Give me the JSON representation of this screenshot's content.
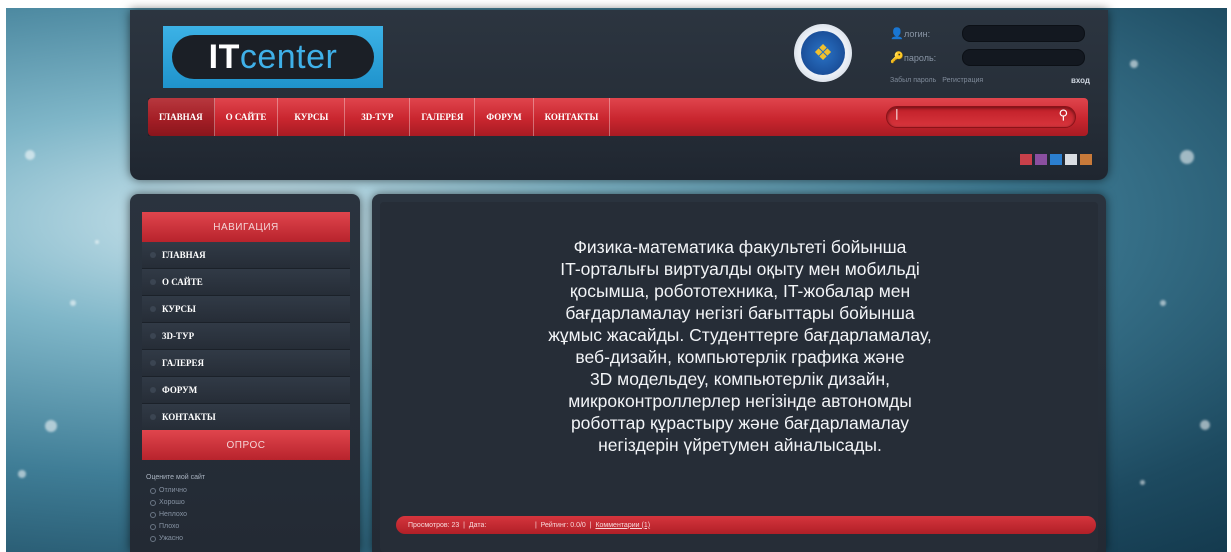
{
  "header": {
    "logo": {
      "prefix": "IT",
      "suffix": "center"
    },
    "emblem_icon": "university-emblem-icon",
    "login": {
      "login_label": "логин:",
      "password_label": "пароль:",
      "links": [
        "Забыл пароль",
        "Регистрация"
      ],
      "submit_label": "вход"
    },
    "nav": [
      "ГЛАВНАЯ",
      "О САЙТЕ",
      "КУРСЫ",
      "3D-ТУР",
      "ГАЛЕРЕЯ",
      "ФОРУМ",
      "КОНТАКТЫ"
    ],
    "search_value": "|"
  },
  "swatches": [
    "#c8404a",
    "#8a4fa0",
    "#2b7fd0",
    "#d9dde2",
    "#c87a3a"
  ],
  "sidebar": {
    "nav_title": "НАВИГАЦИЯ",
    "nav_items": [
      "ГЛАВНАЯ",
      "О САЙТЕ",
      "КУРСЫ",
      "3D-ТУР",
      "ГАЛЕРЕЯ",
      "ФОРУМ",
      "КОНТАКТЫ"
    ],
    "poll_title": "ОПРОС",
    "poll_question": "Оцените мой сайт",
    "poll_options": [
      "Отлично",
      "Хорошо",
      "Неплохо",
      "Плохо",
      "Ужасно"
    ]
  },
  "content": {
    "article_lines": [
      "Физика-математика  факультеті  бойынша",
      "IT-орталығы виртуалды оқыту мен мобильді",
      "қосымша, робототехника, IT-жобалар мен",
      "бағдарламалау негізгі бағыттары бойынша",
      "жұмыс жасайды. Студенттерге бағдарламалау,",
      "веб-дизайн, компьютерлік графика және",
      "3D модельдеу, компьютерлік дизайн,",
      "микроконтроллерлер негізінде автономды",
      "роботтар құрастыру және бағдарламалау",
      "негіздерін үйретумен айналысады."
    ],
    "meta": {
      "views": "Просмотров: 23",
      "date": "Дата:",
      "rating": "Рейтинг: 0.0/0",
      "comments": "Комментарии (1)"
    }
  }
}
